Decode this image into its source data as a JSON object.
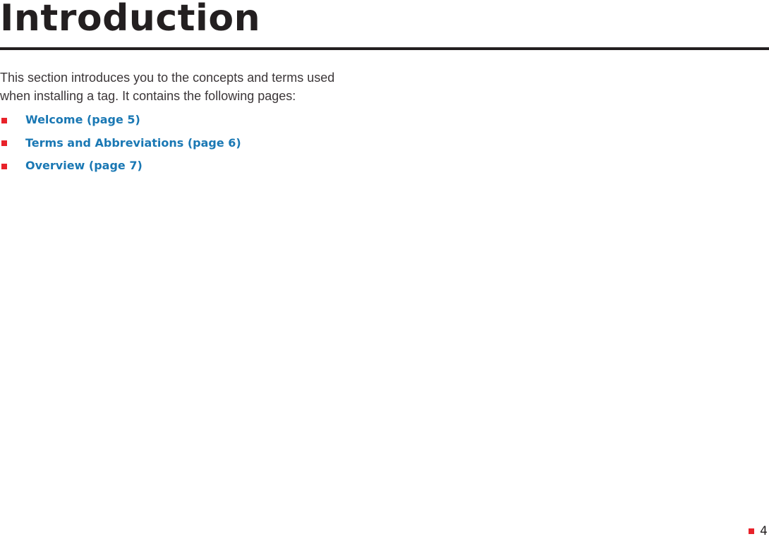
{
  "page": {
    "title": "Introduction",
    "intro_text": "This section introduces you to the concepts and terms used when installing a tag. It contains the following pages:",
    "toc": [
      {
        "label": "Welcome (page 5)"
      },
      {
        "label": "Terms and Abbreviations (page 6)"
      },
      {
        "label": "Overview (page 7)"
      }
    ],
    "page_number": "4"
  },
  "colors": {
    "accent_red": "#e8222a",
    "link_blue": "#1a78b4",
    "text_dark": "#231f20"
  }
}
